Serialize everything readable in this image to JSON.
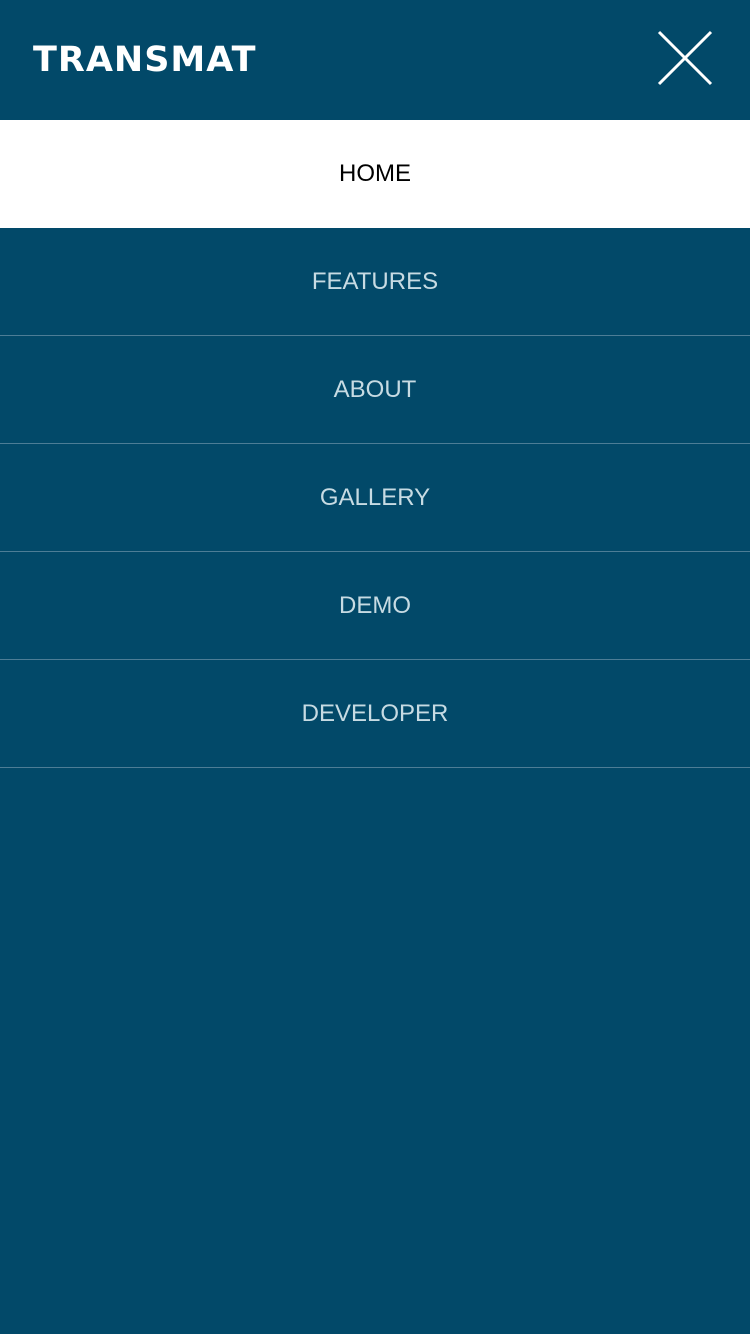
{
  "header": {
    "logo_text": "TRANSMAT",
    "close_icon": "close-icon"
  },
  "nav": {
    "items": [
      {
        "label": "HOME",
        "active": true
      },
      {
        "label": "FEATURES",
        "active": false
      },
      {
        "label": "ABOUT",
        "active": false
      },
      {
        "label": "GALLERY",
        "active": false
      },
      {
        "label": "DEMO",
        "active": false
      },
      {
        "label": "DEVELOPER",
        "active": false
      }
    ]
  },
  "colors": {
    "background": "#024969",
    "active_background": "#ffffff",
    "active_text": "#000000",
    "inactive_text": "#c7dbe3",
    "divider": "#4d7d96",
    "logo": "#ffffff"
  }
}
